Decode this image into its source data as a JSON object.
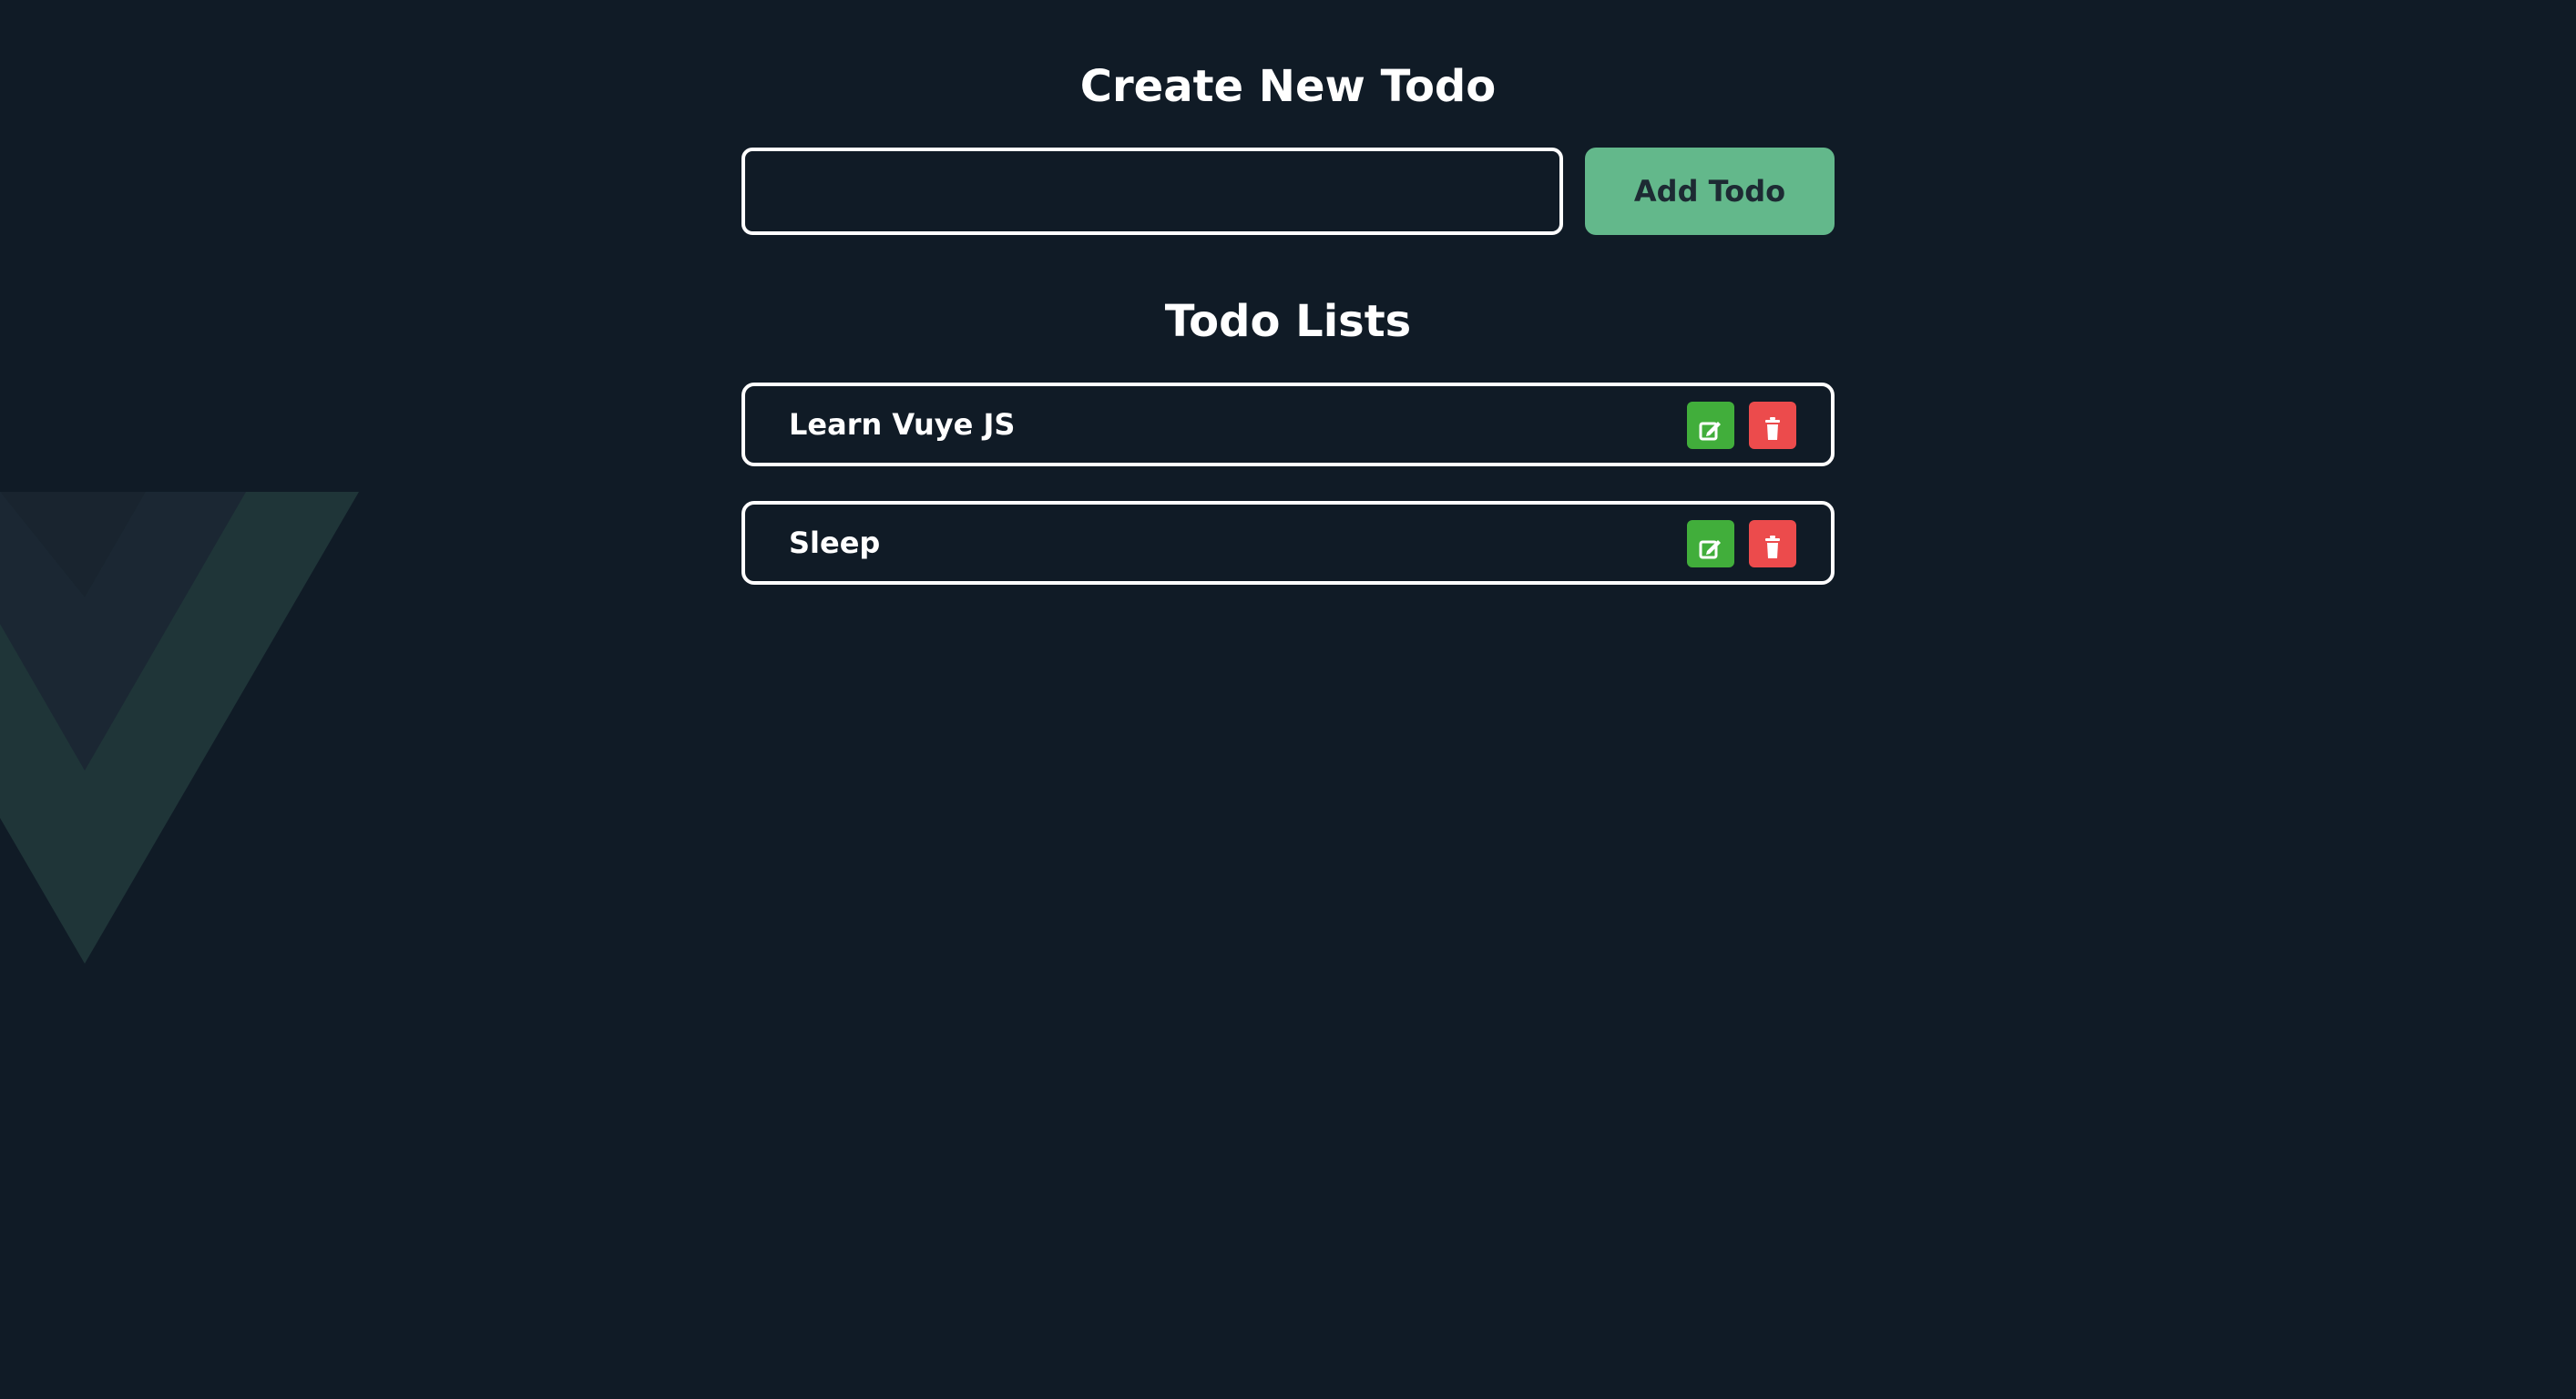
{
  "header": {
    "create_title": "Create New Todo",
    "add_button_label": "Add Todo",
    "input_value": "",
    "input_placeholder": ""
  },
  "todos": {
    "title": "Todo Lists",
    "items": [
      {
        "text": "Learn Vuye JS"
      },
      {
        "text": "Sleep"
      }
    ]
  },
  "icons": {
    "edit": "edit-icon",
    "delete": "trash-icon",
    "background": "vue-logo-icon"
  },
  "colors": {
    "background": "#101b26",
    "accent": "#63b88b",
    "edit": "#41ae3b",
    "delete": "#ec4b4c",
    "border": "#ffffff"
  }
}
